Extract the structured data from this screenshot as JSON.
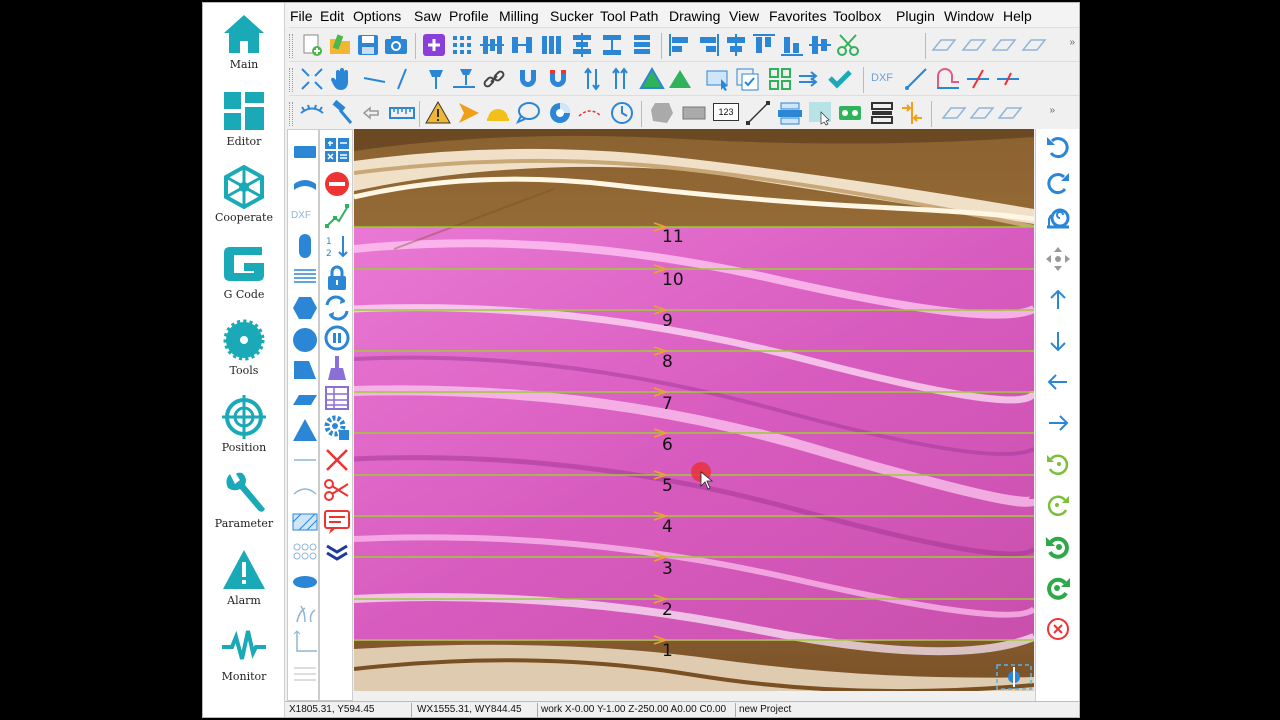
{
  "colors": {
    "accent": "#1aa9b6",
    "blue": "#2b86d6",
    "lane_line": "#9ccc35",
    "lane_fill": "#e35cc7",
    "arrow": "#f0a030",
    "cursor_dot": "#e8323c"
  },
  "nav": [
    {
      "label": "Main",
      "icon": "home-icon"
    },
    {
      "label": "Editor",
      "icon": "editor-grid-icon"
    },
    {
      "label": "Cooperate",
      "icon": "network-icon"
    },
    {
      "label": "G Code",
      "icon": "gcode-icon"
    },
    {
      "label": "Tools",
      "icon": "sawblade-icon"
    },
    {
      "label": "Position",
      "icon": "crosshair-icon"
    },
    {
      "label": "Parameter",
      "icon": "wrench-icon"
    },
    {
      "label": "Alarm",
      "icon": "alarm-icon"
    },
    {
      "label": "Monitor",
      "icon": "pulse-icon"
    }
  ],
  "menu": [
    "File",
    "Edit",
    "Options",
    "Saw",
    "Profile",
    "Milling",
    "Sucker",
    "Tool Path",
    "Drawing",
    "View",
    "Favorites",
    "Toolbox",
    "Plugin",
    "Window",
    "Help"
  ],
  "toolbar_dxf_label": "DXF",
  "toolbar_num_label": "123",
  "palette_dxf_label": "DXF",
  "palette_num_label": "1 2",
  "lanes": [
    "11",
    "10",
    "9",
    "8",
    "7",
    "6",
    "5",
    "4",
    "3",
    "2",
    "1"
  ],
  "status": {
    "coords": "X1805.31, Y594.45",
    "world": "WX1555.31, WY844.45",
    "work": "work X-0.00 Y-1.00 Z-250.00 A0.00 C0.00",
    "project": "new Project"
  }
}
